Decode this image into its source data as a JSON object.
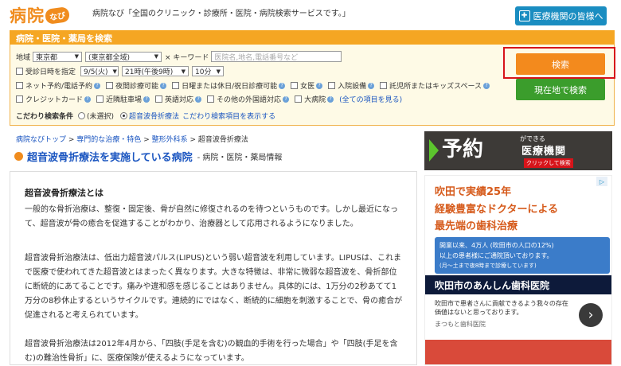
{
  "header": {
    "logo_kanji": "病院",
    "logo_navi": "なび",
    "tagline": "病院なび「全国のクリニック・診療所・医院・病院検索サービスです。」",
    "institution_button": "医療機関の皆様へ"
  },
  "search": {
    "title": "病院・医院・薬局を検索",
    "area_label": "地域",
    "prefecture": "東京都",
    "city": "(東京都全域)",
    "keyword_label": "× キーワード",
    "keyword_placeholder": "医院名,地名,電話番号など",
    "date_label": "受診日時を指定",
    "date_value": "9/5(火)",
    "time_value": "21時(午後9時)",
    "minute_value": "10分",
    "options_row1": [
      "ネット予約/電話予約",
      "夜間診療可能",
      "日曜または休日/祝日診療可能",
      "女医",
      "入院設備",
      "託児所またはキッズスペース"
    ],
    "options_row2": [
      "クレジットカード",
      "近隣駐車場",
      "英語対応",
      "その他の外国語対応",
      "大病院"
    ],
    "all_items_link": "(全ての項目を見る)",
    "condition_label": "こだわり検索条件",
    "radio_unselected": "(未選択)",
    "radio_selected": "超音波骨折療法",
    "condition_link": "こだわり検索項目を表示する",
    "search_button": "検索",
    "location_button": "現在地で検索"
  },
  "breadcrumb": [
    "病院なびトップ",
    "専門的な治療・特色",
    "整形外科系",
    "超音波骨折療法"
  ],
  "page": {
    "title": "超音波骨折療法を実施している病院",
    "subtitle": "- 病院・医院・薬局情報",
    "section_heading": "超音波骨折療法とは",
    "para1": "一般的な骨折治療は、整復・固定後、骨が自然に修復されるのを待つというものです。しかし最近になって、超音波が骨の癒合を促進することがわかり、治療器として応用されるようになりました。",
    "para2": "超音波骨折治療法は、低出力超音波パルス(LIPUS)という弱い超音波を利用しています。LIPUSは、これまで医療で使われてきた超音波とはまったく異なります。大きな特徴は、非常に微弱な超音波を、骨折部位に断続的にあてることです。痛みや違和感を感じることはありません。具体的には、1万分の2秒あてて1万分の8秒休止するというサイクルです。連続的にではなく、断続的に細胞を刺激することで、骨の癒合が促進されると考えられています。",
    "para3": "超音波骨折治療法は2012年4月から、「四肢(手足を含む)の観血的手術を行った場合」や「四肢(手足を含む)の難治性骨折」に、医療保険が使えるようになっています。"
  },
  "ad1": {
    "yoyaku": "予約",
    "small": "ができる",
    "big": "医療機関",
    "tag": "クリックして検索"
  },
  "ad2": {
    "line1": "吹田で実績25年",
    "line2": "経験豊富なドクターによる",
    "line3": "最先端の歯科治療",
    "banner1": "開業以来、4万人 (吹田市の人口の12%)",
    "banner2": "以上の患者様にご通院頂いております。",
    "banner3": "(月〜土まで夜8時まで診療しています)",
    "clinic": "吹田市のあんしん歯科医院",
    "desc": "吹田市で患者さんに貢献できるよう我々の存在価値はないと思っております。",
    "source": "まつもと歯科医院",
    "next": "›"
  },
  "colors": {
    "accent_orange": "#f38a1d",
    "link_blue": "#1a55c0",
    "green": "#3b9d2c",
    "highlight_red": "#d7141a"
  }
}
